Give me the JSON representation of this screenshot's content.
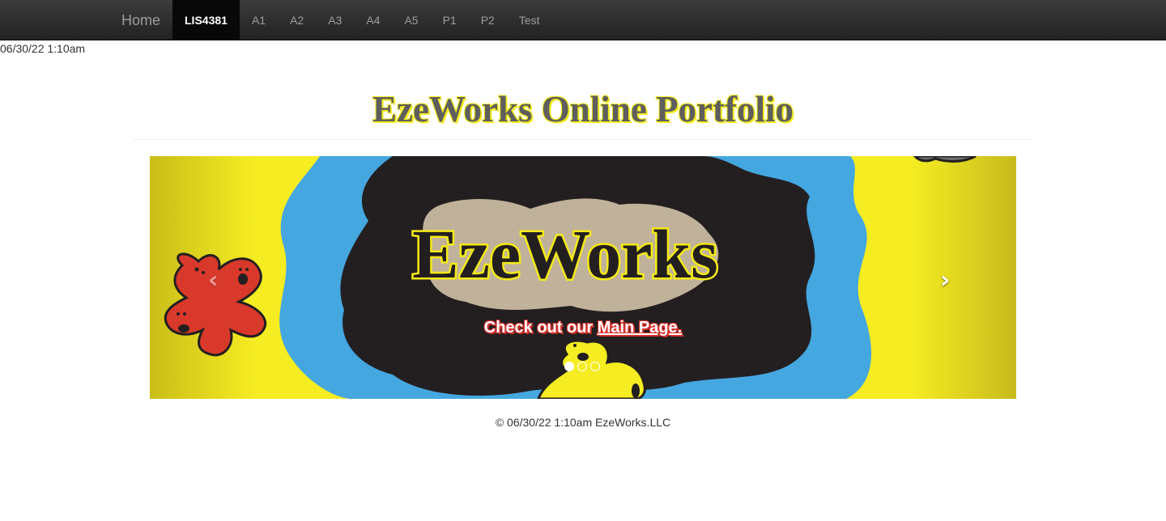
{
  "navbar": {
    "brand": "Home",
    "items": [
      {
        "label": "LIS4381",
        "active": true
      },
      {
        "label": "A1"
      },
      {
        "label": "A2"
      },
      {
        "label": "A3"
      },
      {
        "label": "A4"
      },
      {
        "label": "A5"
      },
      {
        "label": "P1"
      },
      {
        "label": "P2"
      },
      {
        "label": "Test"
      }
    ]
  },
  "timestamp": "06/30/22 1:10am",
  "header": {
    "title": "EzeWorks Online Portfolio"
  },
  "carousel": {
    "logo_text": "EzeWorks",
    "caption_prefix": "Check out our ",
    "caption_link": "Main Page.",
    "prev_icon": "chevron-left-icon",
    "next_icon": "chevron-right-icon",
    "prev_glyph": "‹",
    "next_glyph": "›",
    "slide_count": 3,
    "active_slide": 1
  },
  "footer": {
    "text": "© 06/30/22 1:10am EzeWorks.LLC"
  },
  "colors": {
    "navbar_bg": "#222222",
    "active_tab_bg": "#080808",
    "title_text": "#5e5e5e",
    "title_outline": "#f3ea17",
    "banner_yellow": "#f3ea17",
    "banner_blue": "#45a7e0",
    "banner_black": "#231f20",
    "banner_tan": "#c0b29a",
    "banner_red": "#d9392b",
    "caption_shadow": "#d9302b"
  }
}
